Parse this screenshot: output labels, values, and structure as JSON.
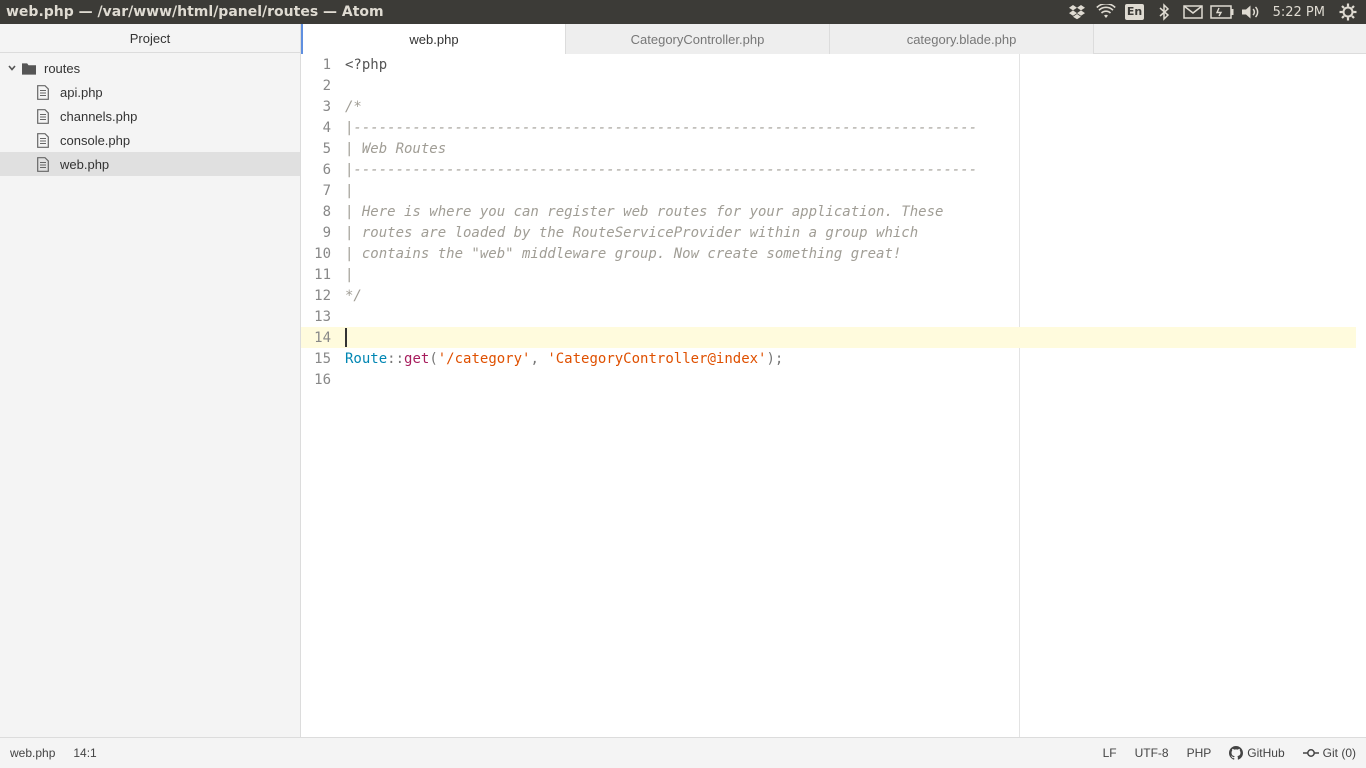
{
  "window": {
    "title": "web.php — /var/www/html/panel/routes — Atom"
  },
  "tray": {
    "keyboard_layout": "En",
    "clock": "5:22 PM",
    "icons": [
      "dropbox-icon",
      "wifi-icon",
      "keyboard-layout-icon",
      "bluetooth-icon",
      "mail-icon",
      "battery-icon",
      "volume-icon",
      "settings-gear-icon"
    ]
  },
  "sidebar": {
    "header": "Project",
    "root_folder": "routes",
    "files": [
      {
        "name": "api.php",
        "selected": false
      },
      {
        "name": "channels.php",
        "selected": false
      },
      {
        "name": "console.php",
        "selected": false
      },
      {
        "name": "web.php",
        "selected": true
      }
    ]
  },
  "tabs": [
    {
      "label": "web.php",
      "active": true
    },
    {
      "label": "CategoryController.php",
      "active": false
    },
    {
      "label": "category.blade.php",
      "active": false
    }
  ],
  "editor": {
    "cursor_line": 14,
    "lines": [
      {
        "n": "1",
        "text": "<?php"
      },
      {
        "n": "2",
        "text": ""
      },
      {
        "n": "3",
        "text": "/*"
      },
      {
        "n": "4",
        "text": "|--------------------------------------------------------------------------"
      },
      {
        "n": "5",
        "text": "| Web Routes"
      },
      {
        "n": "6",
        "text": "|--------------------------------------------------------------------------"
      },
      {
        "n": "7",
        "text": "|"
      },
      {
        "n": "8",
        "text": "| Here is where you can register web routes for your application. These"
      },
      {
        "n": "9",
        "text": "| routes are loaded by the RouteServiceProvider within a group which"
      },
      {
        "n": "10",
        "text": "| contains the \"web\" middleware group. Now create something great!"
      },
      {
        "n": "11",
        "text": "|"
      },
      {
        "n": "12",
        "text": "*/"
      },
      {
        "n": "13",
        "text": ""
      },
      {
        "n": "14",
        "text": ""
      },
      {
        "n": "15",
        "text": "Route::get('/category', 'CategoryController@index');"
      },
      {
        "n": "16",
        "text": ""
      }
    ],
    "route_line": {
      "class": "Route",
      "sep": "::",
      "method": "get",
      "open": "(",
      "path": "'/category'",
      "comma": ", ",
      "handler": "'CategoryController@index'",
      "close": ");"
    }
  },
  "statusbar": {
    "file": "web.php",
    "position": "14:1",
    "line_ending": "LF",
    "encoding": "UTF-8",
    "grammar": "PHP",
    "github": "GitHub",
    "git": "Git (0)"
  }
}
